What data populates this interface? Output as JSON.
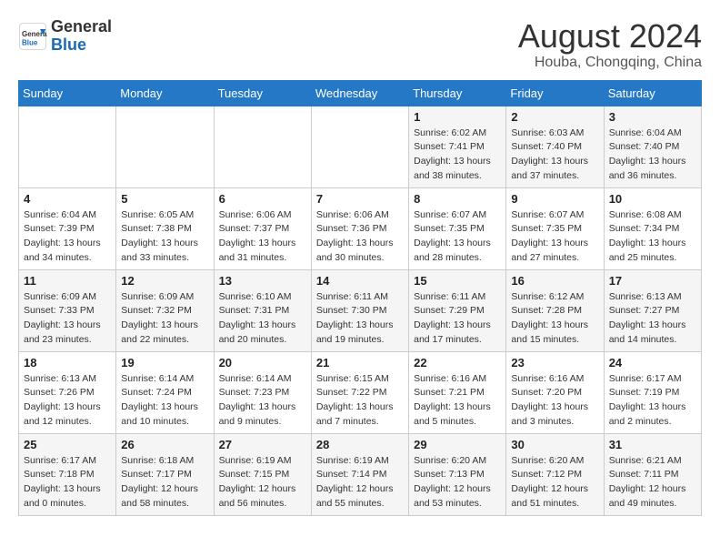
{
  "header": {
    "logo_line1": "General",
    "logo_line2": "Blue",
    "month_year": "August 2024",
    "location": "Houba, Chongqing, China"
  },
  "weekdays": [
    "Sunday",
    "Monday",
    "Tuesday",
    "Wednesday",
    "Thursday",
    "Friday",
    "Saturday"
  ],
  "weeks": [
    [
      {
        "day": "",
        "info": ""
      },
      {
        "day": "",
        "info": ""
      },
      {
        "day": "",
        "info": ""
      },
      {
        "day": "",
        "info": ""
      },
      {
        "day": "1",
        "info": "Sunrise: 6:02 AM\nSunset: 7:41 PM\nDaylight: 13 hours\nand 38 minutes."
      },
      {
        "day": "2",
        "info": "Sunrise: 6:03 AM\nSunset: 7:40 PM\nDaylight: 13 hours\nand 37 minutes."
      },
      {
        "day": "3",
        "info": "Sunrise: 6:04 AM\nSunset: 7:40 PM\nDaylight: 13 hours\nand 36 minutes."
      }
    ],
    [
      {
        "day": "4",
        "info": "Sunrise: 6:04 AM\nSunset: 7:39 PM\nDaylight: 13 hours\nand 34 minutes."
      },
      {
        "day": "5",
        "info": "Sunrise: 6:05 AM\nSunset: 7:38 PM\nDaylight: 13 hours\nand 33 minutes."
      },
      {
        "day": "6",
        "info": "Sunrise: 6:06 AM\nSunset: 7:37 PM\nDaylight: 13 hours\nand 31 minutes."
      },
      {
        "day": "7",
        "info": "Sunrise: 6:06 AM\nSunset: 7:36 PM\nDaylight: 13 hours\nand 30 minutes."
      },
      {
        "day": "8",
        "info": "Sunrise: 6:07 AM\nSunset: 7:35 PM\nDaylight: 13 hours\nand 28 minutes."
      },
      {
        "day": "9",
        "info": "Sunrise: 6:07 AM\nSunset: 7:35 PM\nDaylight: 13 hours\nand 27 minutes."
      },
      {
        "day": "10",
        "info": "Sunrise: 6:08 AM\nSunset: 7:34 PM\nDaylight: 13 hours\nand 25 minutes."
      }
    ],
    [
      {
        "day": "11",
        "info": "Sunrise: 6:09 AM\nSunset: 7:33 PM\nDaylight: 13 hours\nand 23 minutes."
      },
      {
        "day": "12",
        "info": "Sunrise: 6:09 AM\nSunset: 7:32 PM\nDaylight: 13 hours\nand 22 minutes."
      },
      {
        "day": "13",
        "info": "Sunrise: 6:10 AM\nSunset: 7:31 PM\nDaylight: 13 hours\nand 20 minutes."
      },
      {
        "day": "14",
        "info": "Sunrise: 6:11 AM\nSunset: 7:30 PM\nDaylight: 13 hours\nand 19 minutes."
      },
      {
        "day": "15",
        "info": "Sunrise: 6:11 AM\nSunset: 7:29 PM\nDaylight: 13 hours\nand 17 minutes."
      },
      {
        "day": "16",
        "info": "Sunrise: 6:12 AM\nSunset: 7:28 PM\nDaylight: 13 hours\nand 15 minutes."
      },
      {
        "day": "17",
        "info": "Sunrise: 6:13 AM\nSunset: 7:27 PM\nDaylight: 13 hours\nand 14 minutes."
      }
    ],
    [
      {
        "day": "18",
        "info": "Sunrise: 6:13 AM\nSunset: 7:26 PM\nDaylight: 13 hours\nand 12 minutes."
      },
      {
        "day": "19",
        "info": "Sunrise: 6:14 AM\nSunset: 7:24 PM\nDaylight: 13 hours\nand 10 minutes."
      },
      {
        "day": "20",
        "info": "Sunrise: 6:14 AM\nSunset: 7:23 PM\nDaylight: 13 hours\nand 9 minutes."
      },
      {
        "day": "21",
        "info": "Sunrise: 6:15 AM\nSunset: 7:22 PM\nDaylight: 13 hours\nand 7 minutes."
      },
      {
        "day": "22",
        "info": "Sunrise: 6:16 AM\nSunset: 7:21 PM\nDaylight: 13 hours\nand 5 minutes."
      },
      {
        "day": "23",
        "info": "Sunrise: 6:16 AM\nSunset: 7:20 PM\nDaylight: 13 hours\nand 3 minutes."
      },
      {
        "day": "24",
        "info": "Sunrise: 6:17 AM\nSunset: 7:19 PM\nDaylight: 13 hours\nand 2 minutes."
      }
    ],
    [
      {
        "day": "25",
        "info": "Sunrise: 6:17 AM\nSunset: 7:18 PM\nDaylight: 13 hours\nand 0 minutes."
      },
      {
        "day": "26",
        "info": "Sunrise: 6:18 AM\nSunset: 7:17 PM\nDaylight: 12 hours\nand 58 minutes."
      },
      {
        "day": "27",
        "info": "Sunrise: 6:19 AM\nSunset: 7:15 PM\nDaylight: 12 hours\nand 56 minutes."
      },
      {
        "day": "28",
        "info": "Sunrise: 6:19 AM\nSunset: 7:14 PM\nDaylight: 12 hours\nand 55 minutes."
      },
      {
        "day": "29",
        "info": "Sunrise: 6:20 AM\nSunset: 7:13 PM\nDaylight: 12 hours\nand 53 minutes."
      },
      {
        "day": "30",
        "info": "Sunrise: 6:20 AM\nSunset: 7:12 PM\nDaylight: 12 hours\nand 51 minutes."
      },
      {
        "day": "31",
        "info": "Sunrise: 6:21 AM\nSunset: 7:11 PM\nDaylight: 12 hours\nand 49 minutes."
      }
    ]
  ]
}
